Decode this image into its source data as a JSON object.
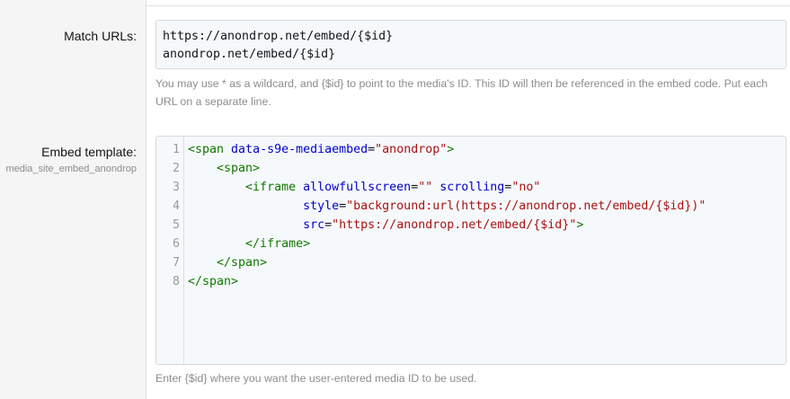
{
  "labels": {
    "match_urls": "Match URLs:",
    "embed_template": "Embed template:",
    "embed_template_sub": "media_site_embed_anondrop"
  },
  "match_urls": {
    "lines": [
      "https://anondrop.net/embed/{$id}",
      "anondrop.net/embed/{$id}"
    ],
    "hint": "You may use * as a wildcard, and {$id} to point to the media's ID. This ID will then be referenced in the embed code. Put each URL on a separate line."
  },
  "embed_template": {
    "line_numbers": [
      "1",
      "2",
      "3",
      "4",
      "5",
      "6",
      "7",
      "8"
    ],
    "lines": [
      [
        {
          "t": "tag",
          "v": "<span "
        },
        {
          "t": "attr",
          "v": "data-s9e-mediaembed"
        },
        {
          "t": "plain",
          "v": "="
        },
        {
          "t": "val",
          "v": "\"anondrop\""
        },
        {
          "t": "tag",
          "v": ">"
        }
      ],
      [
        {
          "t": "plain",
          "v": "    "
        },
        {
          "t": "tag",
          "v": "<span>"
        }
      ],
      [
        {
          "t": "plain",
          "v": "        "
        },
        {
          "t": "tag",
          "v": "<iframe "
        },
        {
          "t": "attr",
          "v": "allowfullscreen"
        },
        {
          "t": "plain",
          "v": "="
        },
        {
          "t": "val",
          "v": "\"\""
        },
        {
          "t": "plain",
          "v": " "
        },
        {
          "t": "attr",
          "v": "scrolling"
        },
        {
          "t": "plain",
          "v": "="
        },
        {
          "t": "val",
          "v": "\"no\""
        }
      ],
      [
        {
          "t": "plain",
          "v": "                "
        },
        {
          "t": "attr",
          "v": "style"
        },
        {
          "t": "plain",
          "v": "="
        },
        {
          "t": "val",
          "v": "\"background:url(https://anondrop.net/embed/{$id})\""
        }
      ],
      [
        {
          "t": "plain",
          "v": "                "
        },
        {
          "t": "attr",
          "v": "src"
        },
        {
          "t": "plain",
          "v": "="
        },
        {
          "t": "val",
          "v": "\"https://anondrop.net/embed/{$id}\""
        },
        {
          "t": "tag",
          "v": ">"
        }
      ],
      [
        {
          "t": "plain",
          "v": "        "
        },
        {
          "t": "tag",
          "v": "</iframe>"
        }
      ],
      [
        {
          "t": "plain",
          "v": "    "
        },
        {
          "t": "tag",
          "v": "</span>"
        }
      ],
      [
        {
          "t": "tag",
          "v": "</span>"
        }
      ]
    ],
    "hint": "Enter {$id} where you want the user-entered media ID to be used."
  }
}
